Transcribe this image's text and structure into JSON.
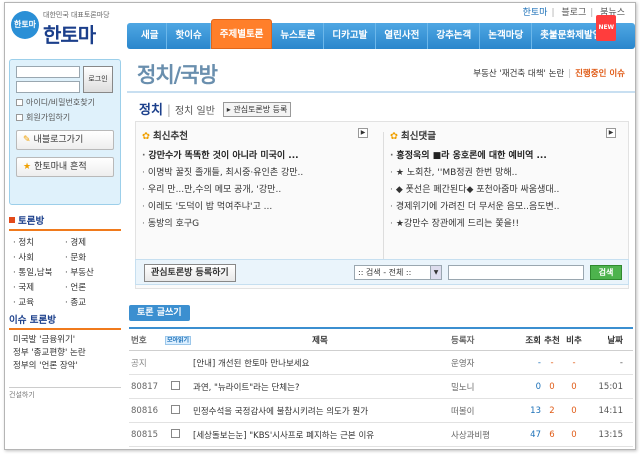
{
  "header": {
    "logo_circle": "한토마",
    "logo_tagline": "대한민국 대표토론마당",
    "logo_name": "한토마",
    "top_links": [
      "한토마",
      "블로그",
      "붐뉴스"
    ]
  },
  "gnb": {
    "items": [
      "새글",
      "핫이슈",
      "주제별토론",
      "뉴스토론",
      "디카고발",
      "열린사전",
      "강추논객",
      "논객마당",
      "촛불문화제발언대"
    ],
    "active_index": 2,
    "new_badge": "NEW"
  },
  "login": {
    "button": "로그인",
    "find_link": "아이디/비밀번호찾기",
    "join_link": "회원가입하기",
    "my_log": "내블로그가기",
    "trace": "한토마내 흔적"
  },
  "categories": {
    "title": "토론방",
    "items": [
      "정치",
      "경제",
      "사회",
      "문화",
      "통일,남북",
      "부동산",
      "국제",
      "언론",
      "교육",
      "종교"
    ]
  },
  "issues": {
    "title": "이슈 토론방",
    "items": [
      "미국발 '금융위기'",
      "정부 '종교편향' 논란",
      "정부의 '언론 장악'"
    ],
    "bottom": "건설하기"
  },
  "banner": {
    "title": "정치/국방",
    "hot_issue": "부동산 '재건축 대책' 논란",
    "ongoing": "진행중인 이슈"
  },
  "subhead": {
    "title": "정치",
    "general": "정치 일반",
    "register": "관심토론방 등록"
  },
  "recommended": {
    "title": "최신추천",
    "items": [
      {
        "text": "강만수가 똑똑한 것이 아니라 미국이 ...",
        "bold": true
      },
      {
        "text": "이명박 꿀짓 졸개들, 최시중·유인촌 강만..",
        "bold": false
      },
      {
        "text": "우리 만...만,수의 메모 공개, '강만..",
        "bold": false
      },
      {
        "text": "이레도 '도덕이 밥 먹여주냐'고 ...",
        "bold": false
      },
      {
        "text": "동방의 호구G",
        "bold": false
      }
    ]
  },
  "comments": {
    "title": "최신댓글",
    "items": [
      {
        "text": "홍정욱의 ■라 옹호론에 대한 예비역 ...",
        "bold": true
      },
      {
        "text": "★ 노회찬, ''MB정권 한번 망해..",
        "bold": false
      },
      {
        "text": "◆ 폿선은 폐간된다◆ 포천아줌마 싸움생대..",
        "bold": false
      },
      {
        "text": "경제위기에 가려진 더 무서운 음모..음도변..",
        "bold": false
      },
      {
        "text": "★강만수 장관에게 드리는 쫓을!!",
        "bold": false
      }
    ]
  },
  "search": {
    "register_button": "관심토론방 등록하기",
    "select_value": ":: 검색 - 전체 ::",
    "button": "검색"
  },
  "write_button": "토론 글쓰기",
  "table": {
    "headers": {
      "num": "번호",
      "read": "모아읽기",
      "title": "제목",
      "author": "등록자",
      "views": "조회",
      "rec": "추천",
      "opp": "비추",
      "date": "날짜"
    },
    "rows": [
      {
        "num": "공지",
        "title": "[안내] 개선된 한토마 만나보세요",
        "author": "운영자",
        "views": "-",
        "rec": "-",
        "opp": "-",
        "date": "-",
        "notice": true
      },
      {
        "num": "80817",
        "title": "과연, \"뉴라이트\"라는 단체는?",
        "author": "밀노니",
        "views": "0",
        "rec": "0",
        "opp": "0",
        "date": "15:01",
        "notice": false
      },
      {
        "num": "80816",
        "title": "민정수석을 국정감사에 불참시키려는 의도가 뭔가",
        "author": "떠볼이",
        "views": "13",
        "rec": "2",
        "opp": "0",
        "date": "14:11",
        "notice": false
      },
      {
        "num": "80815",
        "title": "[세상돌보는눈] \"KBS'시사프로 폐지하는 근본 이유",
        "author": "사상과비평",
        "views": "47",
        "rec": "6",
        "opp": "0",
        "date": "13:15",
        "notice": false
      }
    ]
  },
  "colors": {
    "accent_blue": "#3b8fd0",
    "accent_orange": "#ff7f2a",
    "search_green": "#4db34d"
  }
}
